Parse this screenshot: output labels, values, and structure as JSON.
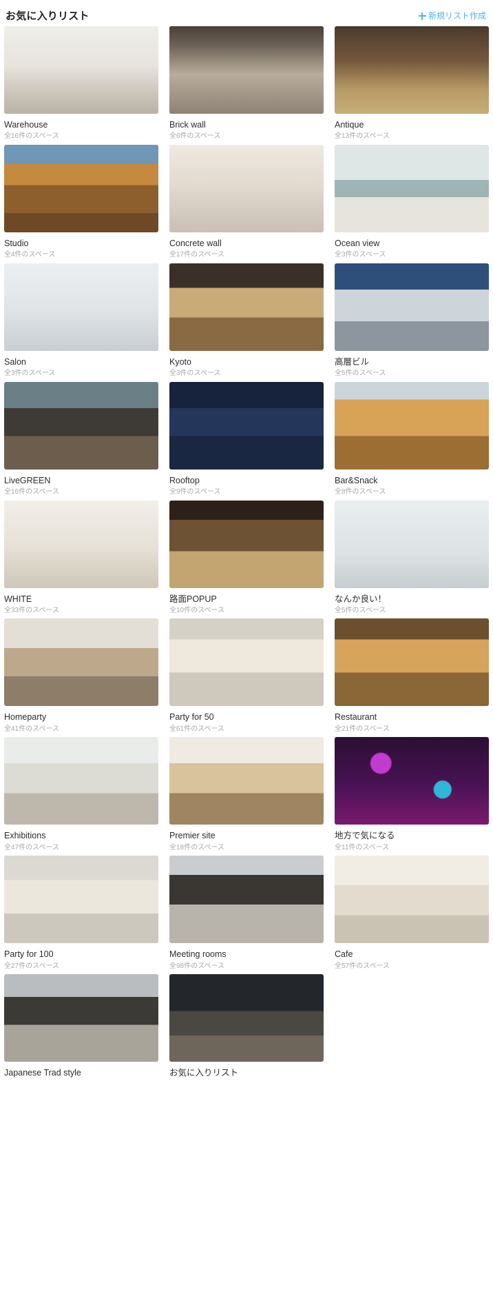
{
  "header": {
    "title": "お気に入りリスト",
    "new_list_label": "新規リスト作成",
    "new_list_icon": "plus-icon",
    "accent_color": "#4eb3e5"
  },
  "lists": [
    {
      "title": "Warehouse",
      "count_label": "全16件のスペース",
      "thumb": "ph-warehouse"
    },
    {
      "title": "Brick wall",
      "count_label": "全6件のスペース",
      "thumb": "ph-brickwall"
    },
    {
      "title": "Antique",
      "count_label": "全13件のスペース",
      "thumb": "ph-antique"
    },
    {
      "title": "Studio",
      "count_label": "全4件のスペース",
      "thumb": "ph-studio"
    },
    {
      "title": "Concrete wall",
      "count_label": "全17件のスペース",
      "thumb": "ph-concrete"
    },
    {
      "title": "Ocean view",
      "count_label": "全3件のスペース",
      "thumb": "ph-ocean"
    },
    {
      "title": "Salon",
      "count_label": "全3件のスペース",
      "thumb": "ph-salon"
    },
    {
      "title": "Kyoto",
      "count_label": "全3件のスペース",
      "thumb": "ph-kyoto"
    },
    {
      "title": "高層ビル",
      "count_label": "全5件のスペース",
      "thumb": "ph-highrise"
    },
    {
      "title": "LiveGREEN",
      "count_label": "全16件のスペース",
      "thumb": "ph-livegreen"
    },
    {
      "title": "Rooftop",
      "count_label": "全9件のスペース",
      "thumb": "ph-rooftop"
    },
    {
      "title": "Bar&Snack",
      "count_label": "全8件のスペース",
      "thumb": "ph-barsnack"
    },
    {
      "title": "WHITE",
      "count_label": "全33件のスペース",
      "thumb": "ph-white"
    },
    {
      "title": "路面POPUP",
      "count_label": "全10件のスペース",
      "thumb": "ph-popup"
    },
    {
      "title": "なんか良い！",
      "count_label": "全5件のスペース",
      "thumb": "ph-nanka"
    },
    {
      "title": "Homeparty",
      "count_label": "全41件のスペース",
      "thumb": "ph-homeparty"
    },
    {
      "title": "Party for 50",
      "count_label": "全61件のスペース",
      "thumb": "ph-party50"
    },
    {
      "title": "Restaurant",
      "count_label": "全21件のスペース",
      "thumb": "ph-restaurant"
    },
    {
      "title": "Exhibitions",
      "count_label": "全47件のスペース",
      "thumb": "ph-exhibitions"
    },
    {
      "title": "Premier site",
      "count_label": "全18件のスペース",
      "thumb": "ph-premier"
    },
    {
      "title": "地方で気になる",
      "count_label": "全11件のスペース",
      "thumb": "ph-chiho"
    },
    {
      "title": "Party for 100",
      "count_label": "全27件のスペース",
      "thumb": "ph-party100"
    },
    {
      "title": "Meeting rooms",
      "count_label": "全98件のスペース",
      "thumb": "ph-meeting"
    },
    {
      "title": "Cafe",
      "count_label": "全57件のスペース",
      "thumb": "ph-cafe"
    },
    {
      "title": "Japanese Trad style",
      "count_label": "",
      "thumb": "ph-jtrad"
    },
    {
      "title": "お気に入りリスト",
      "count_label": "",
      "thumb": "ph-favorite"
    }
  ]
}
